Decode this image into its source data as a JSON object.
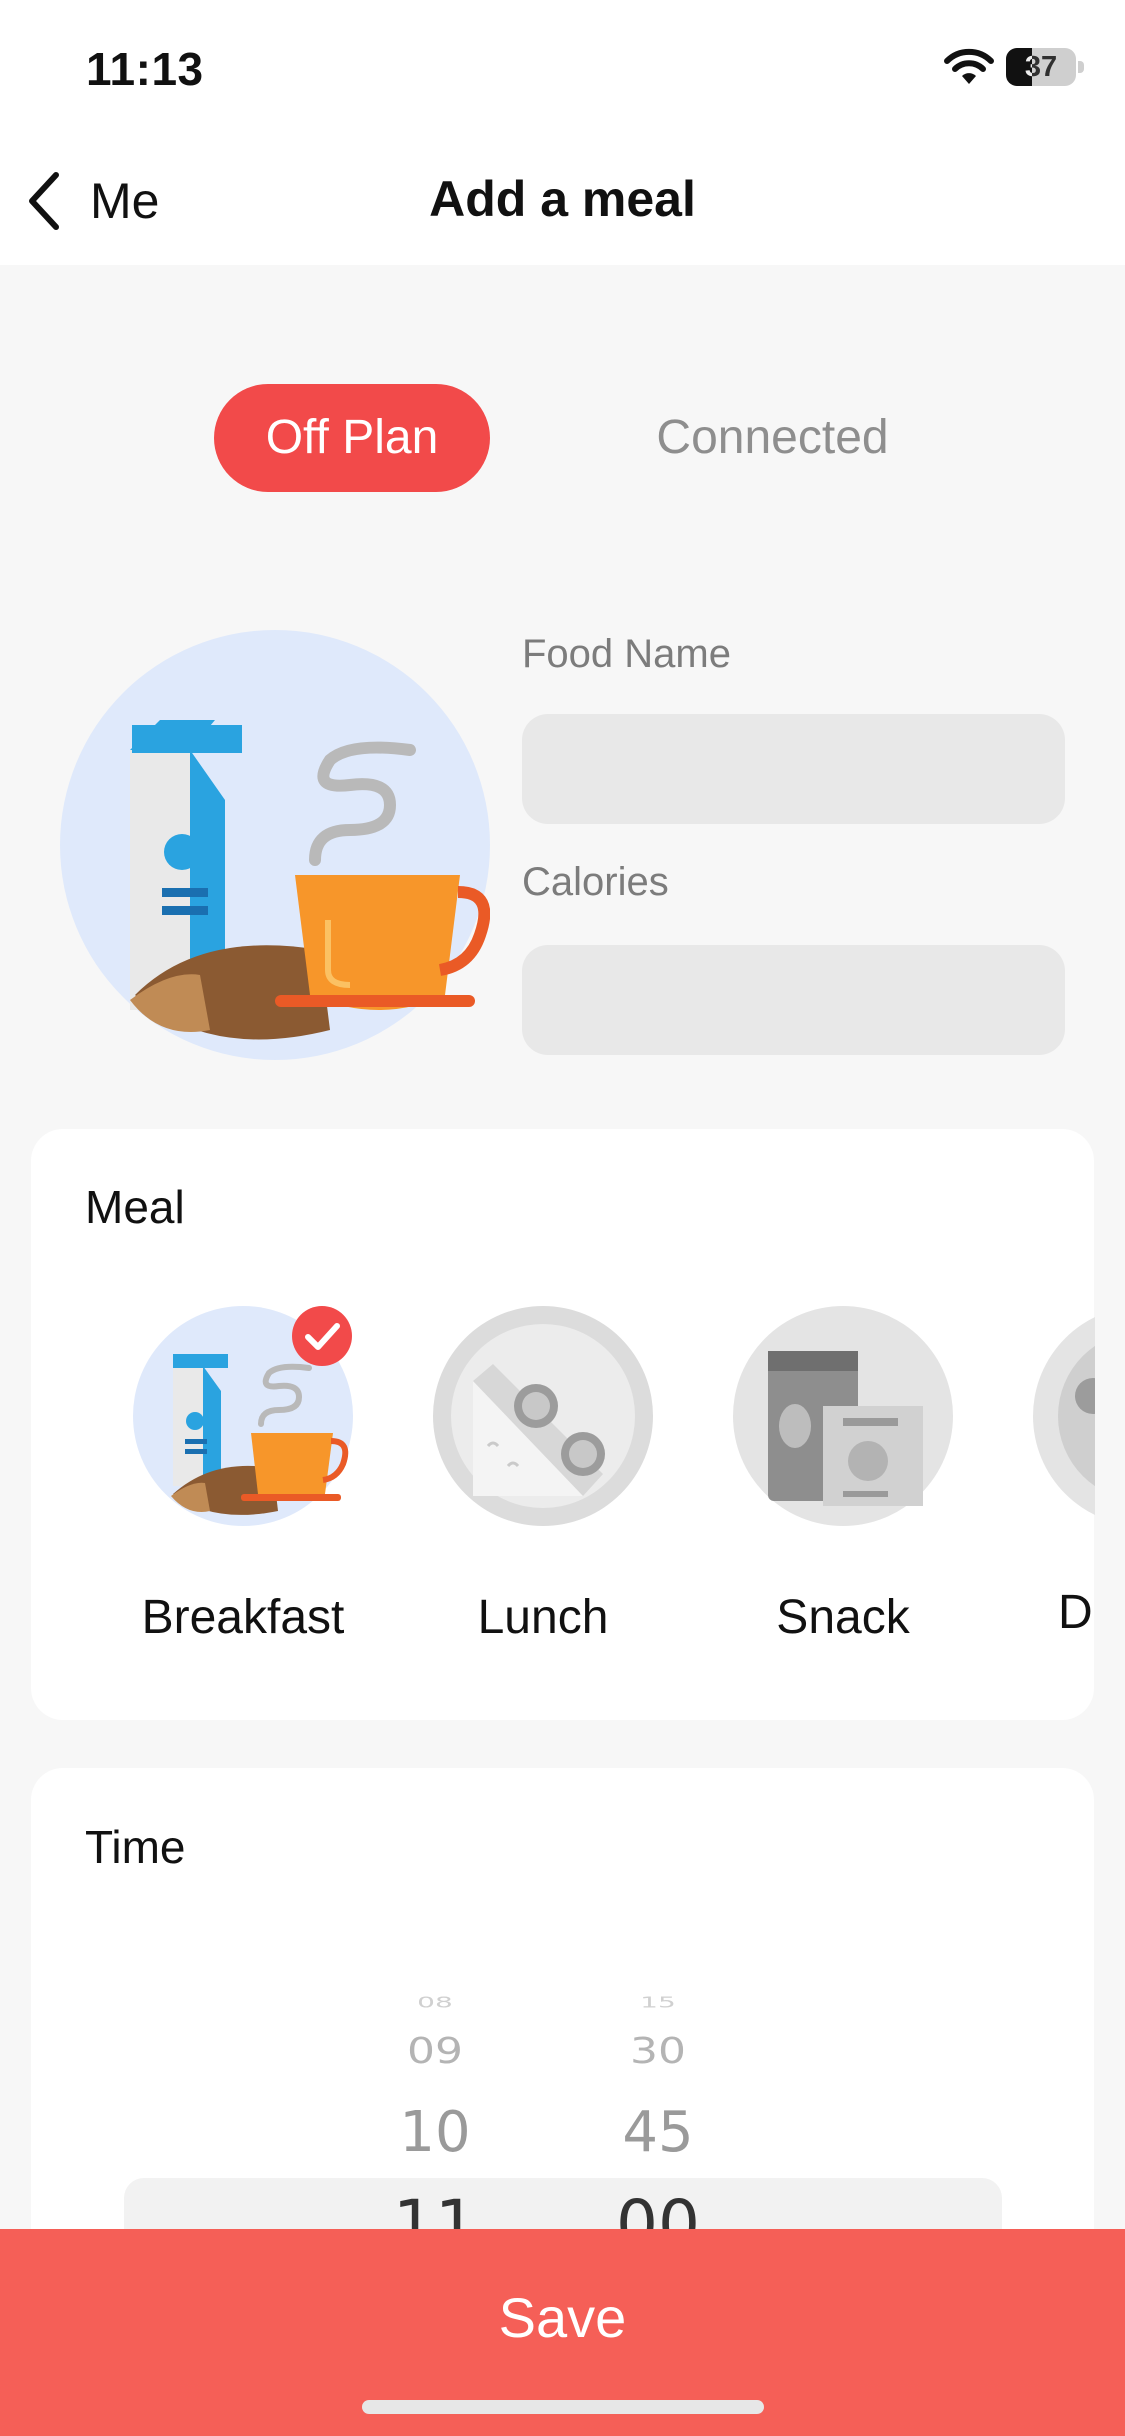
{
  "status_bar": {
    "time": "11:13",
    "battery_level": "37",
    "battery_fraction": 0.37
  },
  "nav": {
    "back_label": "Me",
    "title": "Add a meal"
  },
  "segmented": {
    "options": [
      "Off Plan",
      "Connected"
    ],
    "selected": "Off Plan"
  },
  "food_form": {
    "food_name_label": "Food Name",
    "food_name_value": "",
    "calories_label": "Calories",
    "calories_value": ""
  },
  "meal_section": {
    "title": "Meal",
    "items": [
      {
        "label": "Breakfast",
        "selected": true,
        "icon": "breakfast-icon"
      },
      {
        "label": "Lunch",
        "selected": false,
        "icon": "lunch-sandwich-icon"
      },
      {
        "label": "Snack",
        "selected": false,
        "icon": "snack-icon"
      },
      {
        "label": "D",
        "selected": false,
        "icon": "dinner-icon"
      }
    ]
  },
  "time_section": {
    "title": "Time",
    "hours": [
      "08",
      "09",
      "10",
      "11"
    ],
    "minutes": [
      "15",
      "30",
      "45",
      "00"
    ],
    "selected_hour": "11",
    "selected_minute": "00"
  },
  "save_button": {
    "label": "Save"
  },
  "colors": {
    "accent": "#f24a4a",
    "save_bar": "#f55f57",
    "input_bg": "#e8e8e8"
  }
}
